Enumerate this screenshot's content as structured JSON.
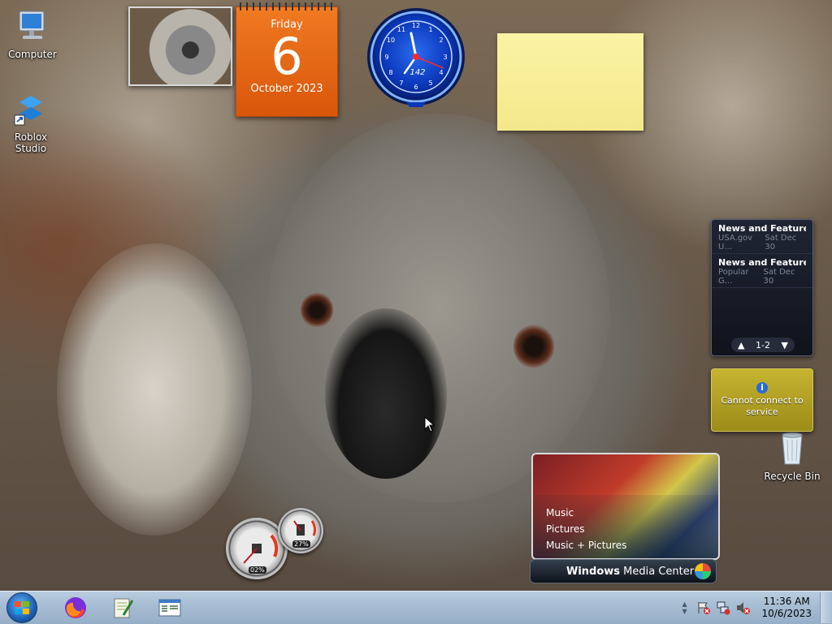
{
  "desktop": {
    "icons": [
      {
        "label": "Computer",
        "icon": "computer-icon"
      },
      {
        "label": "Roblox Studio",
        "icon": "roblox-studio-icon"
      },
      {
        "label": "Recycle Bin",
        "icon": "recycle-bin-icon"
      }
    ]
  },
  "gadgets": {
    "calendar": {
      "weekday": "Friday",
      "day": "6",
      "month_year": "October 2023"
    },
    "clock": {
      "label": "142",
      "time": "11:36"
    },
    "feeds": {
      "items": [
        {
          "title": "News and Features f...",
          "source": "USA.gov U...",
          "date": "Sat Dec 30"
        },
        {
          "title": "News and Features f...",
          "source": "Popular G...",
          "date": "Sat Dec 30"
        }
      ],
      "page": "1-2"
    },
    "weather": {
      "message": "Cannot connect to service"
    },
    "cpu_meter": {
      "cpu": "02%",
      "ram": "27%",
      "cpu_value": 0.02,
      "ram_value": 0.27
    },
    "media_center": {
      "menu": [
        "Music",
        "Pictures",
        "Music + Pictures"
      ],
      "brand_bold": "Windows",
      "brand_rest": " Media Center"
    }
  },
  "taskbar": {
    "pinned": [
      "firefox-icon",
      "notepad-plus-plus-icon",
      "document-viewer-icon"
    ],
    "clock": {
      "time": "11:36 AM",
      "date": "10/6/2023"
    }
  },
  "colors": {
    "calendar": "#e8650f",
    "note": "#f8ee9a",
    "taskbar": "#a6bcd2"
  }
}
